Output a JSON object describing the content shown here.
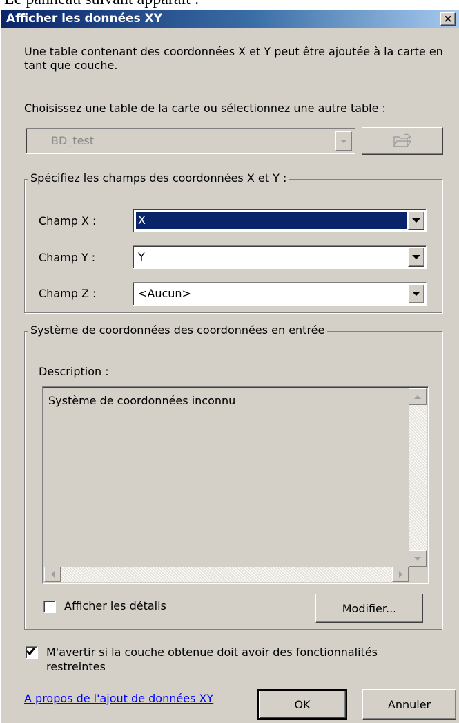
{
  "document": {
    "caption": "Le panneau suivant apparaît :"
  },
  "window": {
    "title": "Afficher les données XY",
    "close_symbol": "×"
  },
  "intro_text": "Une table contenant des coordonnées X et Y peut être ajoutée à la carte en tant que couche.",
  "table_prompt": "Choisissez une table de la carte ou sélectionnez une autre table :",
  "table_combo": {
    "value": "BD_test",
    "disabled": true
  },
  "fields_group": {
    "legend": "Spécifiez les champs des coordonnées X et Y :",
    "fields": [
      {
        "label": "Champ X :",
        "value": "X",
        "selected": true
      },
      {
        "label": "Champ Y :",
        "value": "Y",
        "selected": false
      },
      {
        "label": "Champ Z :",
        "value": "<Aucun>",
        "selected": false
      }
    ]
  },
  "coord_group": {
    "legend": "Système de coordonnées des coordonnées en entrée",
    "description_label": "Description :",
    "description_text": "Système de coordonnées inconnu",
    "show_details_label": "Afficher les détails",
    "show_details_checked": false,
    "modify_label": "Modifier..."
  },
  "warn_checkbox": {
    "label": "M'avertir si la couche obtenue doit avoir des fonctionnalités restreintes",
    "checked": true
  },
  "help_link": "A propos de l'ajout de données XY",
  "buttons": {
    "ok": "OK",
    "cancel": "Annuler"
  },
  "colors": {
    "titlebar_start": "#0a246a",
    "face": "#d4d0c8",
    "selection": "#0a246a",
    "link": "#0000ff"
  }
}
